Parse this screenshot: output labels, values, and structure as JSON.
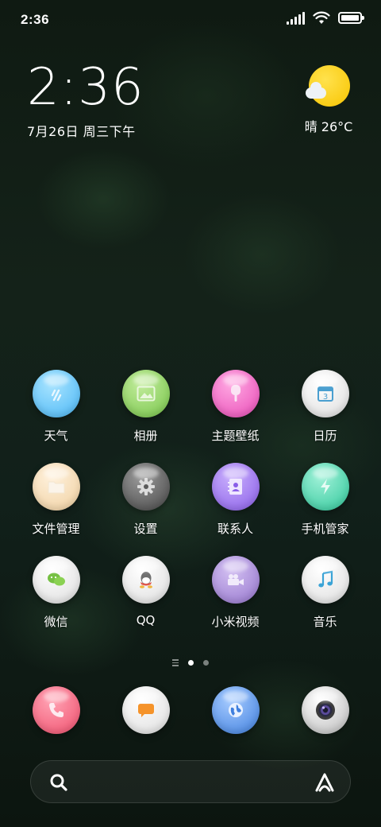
{
  "status_bar": {
    "time": "2:36",
    "icons": [
      "signal-icon",
      "wifi-icon",
      "battery-icon"
    ]
  },
  "clock": {
    "time": "2:36",
    "date": "7月26日 周三下午"
  },
  "weather": {
    "text": "晴 26°C",
    "icon": "sunny-cloud-icon"
  },
  "apps": [
    {
      "label": "天气",
      "icon": "weather-icon",
      "color": "#6cc8ff"
    },
    {
      "label": "相册",
      "icon": "gallery-icon",
      "color": "#8bd160"
    },
    {
      "label": "主题壁纸",
      "icon": "themes-icon",
      "color": "#f06bc6"
    },
    {
      "label": "日历",
      "icon": "calendar-icon",
      "color": "#f3f3f3"
    },
    {
      "label": "文件管理",
      "icon": "folder-icon",
      "color": "#f4dcb8"
    },
    {
      "label": "设置",
      "icon": "gear-icon",
      "color": "#5c5c5c"
    },
    {
      "label": "联系人",
      "icon": "contacts-icon",
      "color": "#9e73f3"
    },
    {
      "label": "手机管家",
      "icon": "security-icon",
      "color": "#4fd7b0"
    },
    {
      "label": "微信",
      "icon": "wechat-icon",
      "color": "#f3f3f3"
    },
    {
      "label": "QQ",
      "icon": "qq-icon",
      "color": "#f3f3f3"
    },
    {
      "label": "小米视频",
      "icon": "video-icon",
      "color": "#a98ad9"
    },
    {
      "label": "音乐",
      "icon": "music-icon",
      "color": "#f3f3f3"
    }
  ],
  "page_indicator": {
    "current": 1,
    "total": 2
  },
  "dock": [
    {
      "icon": "phone-icon",
      "color": "#f4607a"
    },
    {
      "icon": "messages-icon",
      "color": "#f3f3f3"
    },
    {
      "icon": "browser-icon",
      "color": "#4f8fe6"
    },
    {
      "icon": "camera-icon",
      "color": "#d9d9d9"
    }
  ],
  "search_bar": {
    "search_icon": "search-icon",
    "assistant_icon": "assistant-icon"
  }
}
